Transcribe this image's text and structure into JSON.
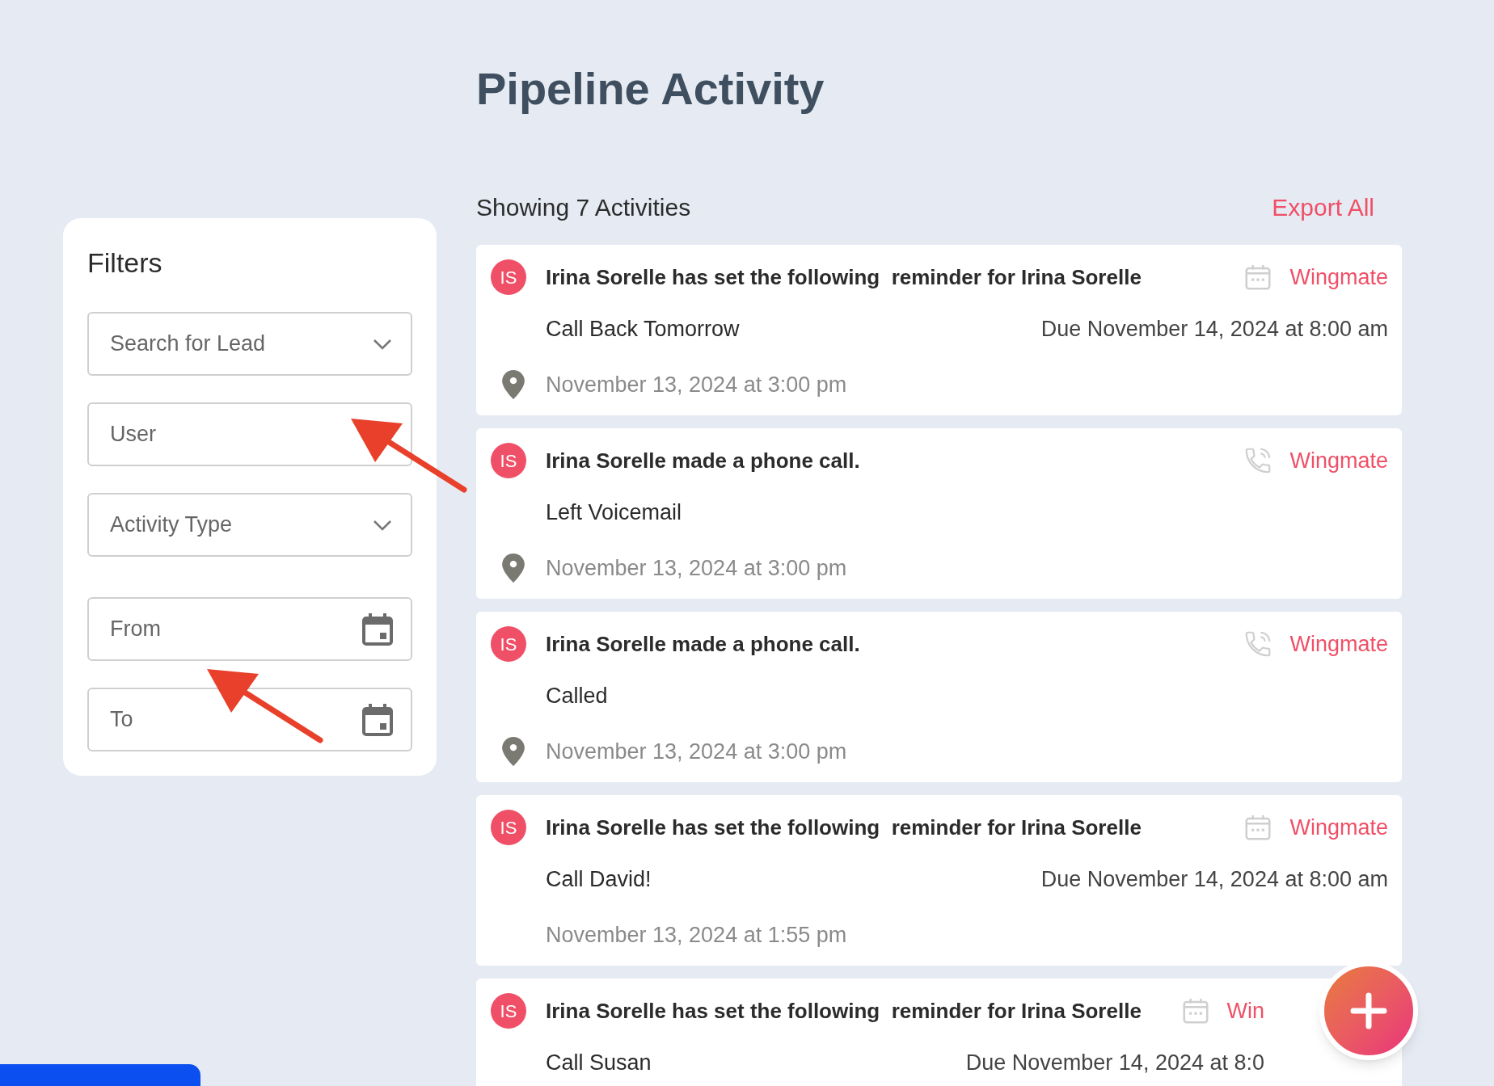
{
  "page_title": "Pipeline Activity",
  "filters": {
    "title": "Filters",
    "fields": [
      {
        "kind": "dropdown",
        "placeholder": "Search for Lead"
      },
      {
        "kind": "text",
        "placeholder": "User"
      },
      {
        "kind": "dropdown",
        "placeholder": "Activity Type"
      },
      {
        "kind": "date",
        "placeholder": "From"
      },
      {
        "kind": "date",
        "placeholder": "To"
      }
    ]
  },
  "summary": "Showing 7 Activities",
  "export_link": "Export All",
  "activities": [
    {
      "kind": "reminder",
      "avatar": "IS",
      "headline": "Irina Sorelle has set the following  reminder for Irina Sorelle",
      "source": "Wingmate",
      "detail": "Call Back Tomorrow",
      "due": "Due November 14, 2024 at 8:00 am",
      "location": true,
      "timestamp": "November 13, 2024 at 3:00 pm"
    },
    {
      "kind": "call",
      "avatar": "IS",
      "headline": "Irina Sorelle made a phone call.",
      "source": "Wingmate",
      "detail": "Left Voicemail",
      "location": true,
      "timestamp": "November 13, 2024 at 3:00 pm"
    },
    {
      "kind": "call",
      "avatar": "IS",
      "headline": "Irina Sorelle made a phone call.",
      "source": "Wingmate",
      "detail": "Called",
      "location": true,
      "timestamp": "November 13, 2024 at 3:00 pm"
    },
    {
      "kind": "reminder",
      "avatar": "IS",
      "headline": "Irina Sorelle has set the following  reminder for Irina Sorelle",
      "source": "Wingmate",
      "detail": "Call David!",
      "due": "Due November 14, 2024 at 8:00 am",
      "location": false,
      "timestamp": "November 13, 2024 at 1:55 pm"
    },
    {
      "kind": "reminder",
      "avatar": "IS",
      "headline": "Irina Sorelle has set the following  reminder for Irina Sorelle",
      "source": "Win",
      "detail": "Call Susan",
      "due": "Due November 14, 2024 at 8:0"
    }
  ]
}
